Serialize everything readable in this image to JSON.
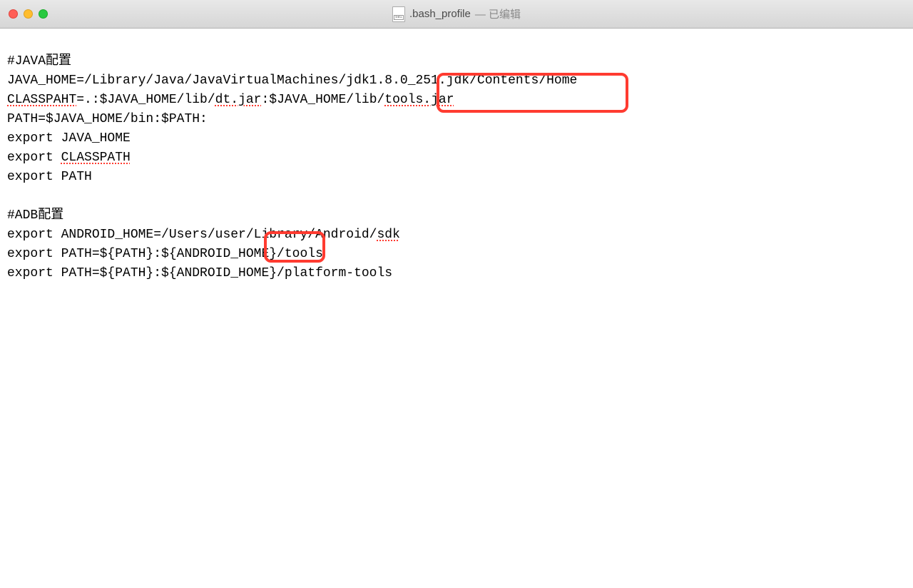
{
  "titlebar": {
    "filename": ".bash_profile",
    "edited": "— 已编辑"
  },
  "lines": {
    "l0": "#JAVA配置",
    "l1_a": "JAVA_HOME=/Library/Java/JavaVirtualMachines/jdk1.8.0_251.jdk/Contents/Home",
    "l2_a": "CLASSPAHT",
    "l2_b": "=.:$JAVA_HOME/lib/",
    "l2_c": "dt.jar",
    "l2_d": ":$JAVA_HOME/lib/",
    "l2_e": "tools.jar",
    "l3": "PATH=$JAVA_HOME/bin:$PATH:",
    "l4": "export JAVA_HOME",
    "l5_a": "export ",
    "l5_b": "CLASSPATH",
    "l6": "export PATH",
    "l7": "",
    "l8": "#ADB配置",
    "l9_a": "export ANDROID_HOME=/Users/user/Library/Android/",
    "l9_b": "sdk",
    "l10": "export PATH=${PATH}:${ANDROID_HOME}/tools",
    "l11": "export PATH=${PATH}:${ANDROID_HOME}/platform-tools"
  }
}
